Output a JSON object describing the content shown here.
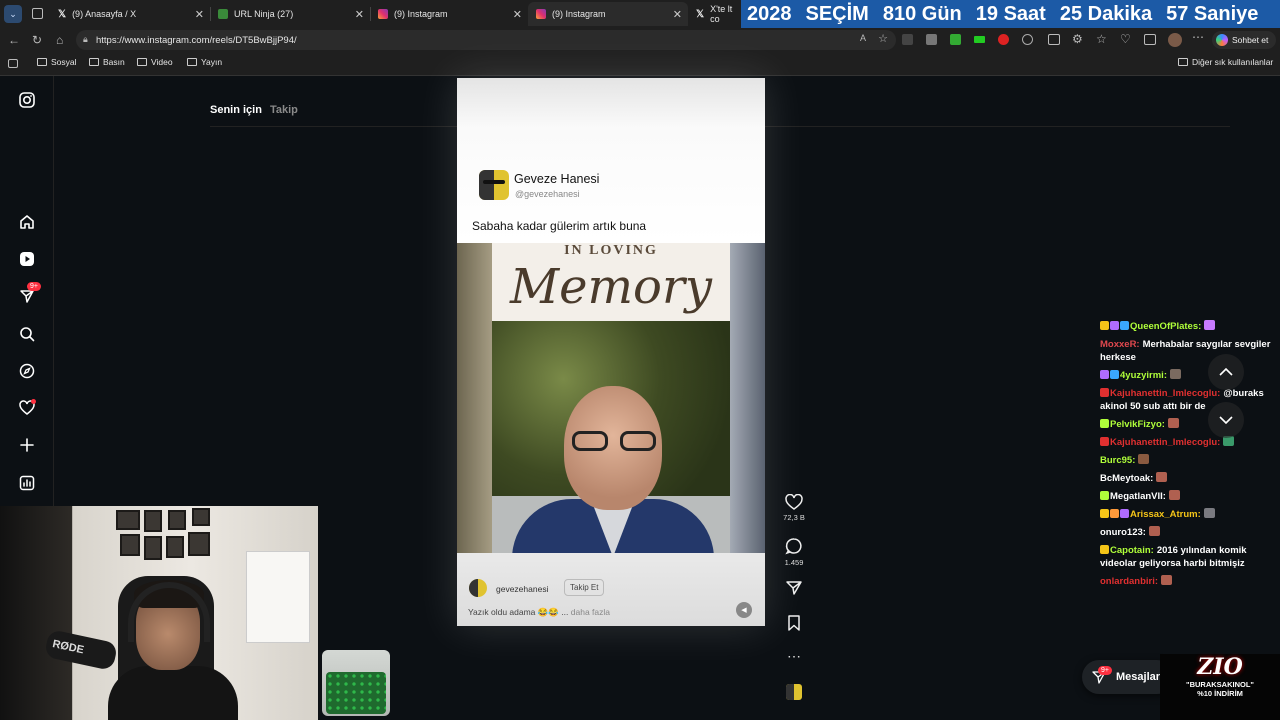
{
  "browser": {
    "tabs": [
      {
        "title": "(9) Anasayfa / X",
        "favicon": "x-logo-icon"
      },
      {
        "title": "URL Ninja (27)",
        "favicon": "ninja-icon"
      },
      {
        "title": "(9) Instagram",
        "favicon": "instagram-icon"
      },
      {
        "title": "(9) Instagram",
        "favicon": "instagram-icon"
      },
      {
        "title": "X'te lt co",
        "favicon": "x-logo-icon"
      }
    ],
    "url": "https://www.instagram.com/reels/DT5BwBjjP94/",
    "copilot_label": "Sohbet et",
    "bookmarks": [
      "Sosyal",
      "Basın",
      "Video",
      "Yayın"
    ],
    "other_bookmarks": "Diğer sık kullanılanlar"
  },
  "countdown": {
    "parts": [
      "2028",
      "SEÇİM",
      "810 Gün",
      "19 Saat",
      "25 Dakika",
      "57 Saniye"
    ]
  },
  "instagram": {
    "feed_tabs": [
      "Senin için",
      "Takip"
    ],
    "notification_badge": "9+",
    "reel": {
      "tweet_author": "Geveze Hanesi",
      "tweet_handle": "@gevezehanesi",
      "tweet_text": "Sabaha kadar gülerim artık buna",
      "image_header": "IN LOVING",
      "image_word": "Memory",
      "owner": "gevezehanesi",
      "follow_label": "Takip Et",
      "caption": "Yazık oldu adama 😂😂 ...",
      "more_label": "daha fazla"
    },
    "actions": {
      "likes": "72,3 B",
      "comments": "1.459"
    },
    "messages_label": "Mesajlar",
    "messages_badge": "9+"
  },
  "chat": {
    "messages": [
      {
        "user": "QueenOfPlates:",
        "text": "",
        "color": "#b0ff3a",
        "badges": [
          "#f5c518",
          "#b06cff",
          "#3aa7ff"
        ],
        "emote": "#c87bff"
      },
      {
        "user": "MoxxeR:",
        "text": "Merhabalar saygılar sevgiler herkese",
        "color": "#e0484e",
        "badges": [],
        "emote": ""
      },
      {
        "user": "4yuzyirmi:",
        "text": "",
        "color": "#b0ff3a",
        "badges": [
          "#b06cff",
          "#3aa7ff"
        ],
        "emote": "#7a6a60"
      },
      {
        "user": "Kajuhanettin_Imlecoglu:",
        "text": "@buraks akinol 50 sub attı bir de",
        "color": "#e03030",
        "badges": [
          "#e03030"
        ],
        "emote": ""
      },
      {
        "user": "PelvikFizyo:",
        "text": "",
        "color": "#b0ff3a",
        "badges": [
          "#b0ff3a"
        ],
        "emote": "#b06050"
      },
      {
        "user": "Kajuhanettin_Imlecoglu:",
        "text": "",
        "color": "#e03030",
        "badges": [
          "#e03030"
        ],
        "emote": "#3a9a6a"
      },
      {
        "user": "Burc95:",
        "text": "",
        "color": "#b0ff3a",
        "badges": [],
        "emote": "#8a5a40"
      },
      {
        "user": "BcMeytoak:",
        "text": "",
        "color": "#ffffff",
        "badges": [],
        "emote": "#b06050"
      },
      {
        "user": "MegatlanVII:",
        "text": "",
        "color": "#ffffff",
        "badges": [
          "#b0ff3a"
        ],
        "emote": "#b06050"
      },
      {
        "user": "Arissax_Atrum:",
        "text": "",
        "color": "#f5c518",
        "badges": [
          "#f5c518",
          "#ff9a3a",
          "#b06cff"
        ],
        "emote": "#7a7a80"
      },
      {
        "user": "onuro123:",
        "text": "",
        "color": "#ffffff",
        "badges": [],
        "emote": "#b06050"
      },
      {
        "user": "Capotain:",
        "text": "2016 yılından komik videolar geliyorsa harbi bitmişiz",
        "color": "#b0ff3a",
        "badges": [
          "#f5c518"
        ],
        "emote": ""
      },
      {
        "user": "onlardanbiri:",
        "text": "",
        "color": "#e03030",
        "badges": [],
        "emote": "#b06050"
      }
    ]
  },
  "promo": {
    "brand": "ZIO",
    "line1": "\"BURAKSAKINOL\"",
    "line2": "%10 İNDİRİM"
  },
  "webcam": {
    "mic_label": "RØDE"
  }
}
